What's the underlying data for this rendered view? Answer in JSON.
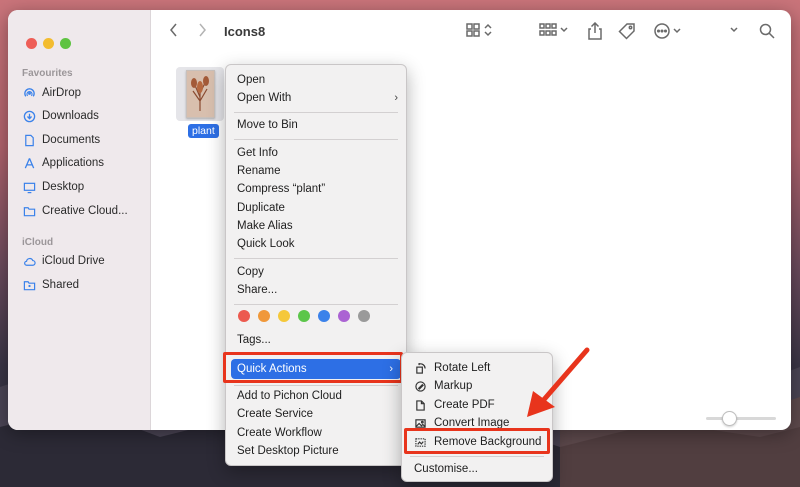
{
  "window": {
    "title": "Icons8"
  },
  "sidebar": {
    "sections": [
      {
        "heading": "Favourites",
        "items": [
          {
            "label": "AirDrop",
            "icon": "airdrop-icon"
          },
          {
            "label": "Downloads",
            "icon": "download-icon"
          },
          {
            "label": "Documents",
            "icon": "document-icon"
          },
          {
            "label": "Applications",
            "icon": "applications-icon"
          },
          {
            "label": "Desktop",
            "icon": "desktop-icon"
          },
          {
            "label": "Creative Cloud...",
            "icon": "folder-icon"
          }
        ]
      },
      {
        "heading": "iCloud",
        "items": [
          {
            "label": "iCloud Drive",
            "icon": "cloud-icon"
          },
          {
            "label": "Shared",
            "icon": "shared-folder-icon"
          }
        ]
      }
    ]
  },
  "file": {
    "name": "plant"
  },
  "context_menu": {
    "items": [
      "Open",
      "Open With",
      "Move to Bin",
      "Get Info",
      "Rename",
      "Compress “plant”",
      "Duplicate",
      "Make Alias",
      "Quick Look",
      "Copy",
      "Share...",
      "Tags...",
      "Quick Actions",
      "Add to Pichon Cloud",
      "Create Service",
      "Create Workflow",
      "Set Desktop Picture"
    ],
    "tag_colors": [
      "#ec5a4f",
      "#f0983a",
      "#f5c83a",
      "#5cc64a",
      "#3b82ea",
      "#ab63d3",
      "#9a9a9a"
    ]
  },
  "submenu": {
    "items": [
      {
        "label": "Rotate Left",
        "icon": "rotate-left-icon"
      },
      {
        "label": "Markup",
        "icon": "markup-icon"
      },
      {
        "label": "Create PDF",
        "icon": "pdf-icon"
      },
      {
        "label": "Convert Image",
        "icon": "image-icon"
      },
      {
        "label": "Remove Background",
        "icon": "remove-background-icon"
      },
      {
        "label": "Customise...",
        "icon": ""
      }
    ]
  },
  "colors": {
    "highlight": "#e8341c",
    "selection": "#2d6fe5"
  }
}
